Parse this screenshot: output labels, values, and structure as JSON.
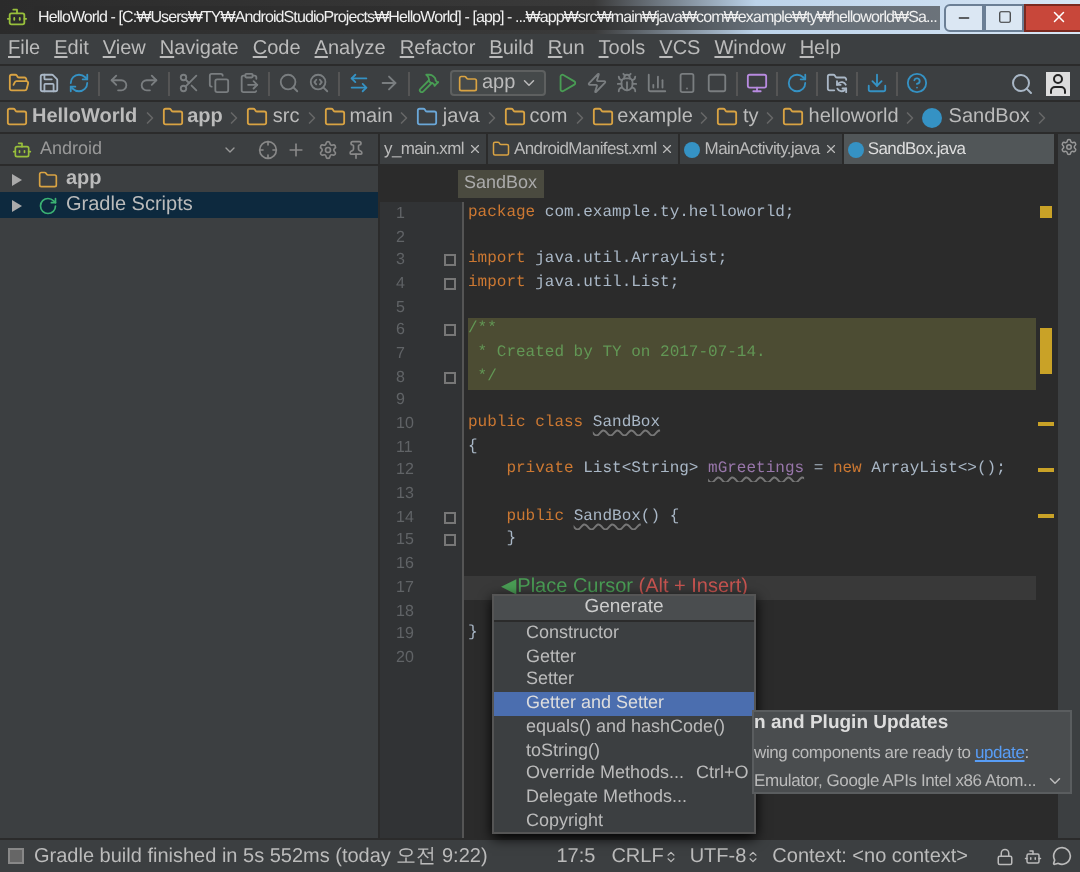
{
  "window": {
    "title": "HelloWorld - [C:₩Users₩TY₩AndroidStudioProjects₩HelloWorld] - [app] - ...₩app₩src₩main₩java₩com₩example₩ty₩helloworld₩Sa..."
  },
  "menu": [
    "File",
    "Edit",
    "View",
    "Navigate",
    "Code",
    "Analyze",
    "Refactor",
    "Build",
    "Run",
    "Tools",
    "VCS",
    "Window",
    "Help"
  ],
  "toolbar": {
    "run_config": "app"
  },
  "breadcrumbs": [
    {
      "label": "HelloWorld",
      "kind": "project"
    },
    {
      "label": "app",
      "kind": "module"
    },
    {
      "label": "src",
      "kind": "folder"
    },
    {
      "label": "main",
      "kind": "folder"
    },
    {
      "label": "java",
      "kind": "source"
    },
    {
      "label": "com",
      "kind": "package"
    },
    {
      "label": "example",
      "kind": "package"
    },
    {
      "label": "ty",
      "kind": "package"
    },
    {
      "label": "helloworld",
      "kind": "package"
    },
    {
      "label": "SandBox",
      "kind": "class"
    }
  ],
  "project_panel": {
    "view": "Android",
    "tree": [
      {
        "label": "app",
        "kind": "module",
        "selected": false
      },
      {
        "label": "Gradle Scripts",
        "kind": "gradle",
        "selected": true
      }
    ]
  },
  "editor_tabs": [
    {
      "label": "y_main.xml",
      "kind": "xml",
      "selected": false
    },
    {
      "label": "AndroidManifest.xml",
      "kind": "manifest",
      "selected": false
    },
    {
      "label": "MainActivity.java",
      "kind": "class",
      "selected": false
    },
    {
      "label": "SandBox.java",
      "kind": "class",
      "selected": true
    }
  ],
  "editor": {
    "breadcrumb": "SandBox",
    "lines": [
      {
        "n": "1",
        "fold": false,
        "highlighted": false,
        "current": false,
        "tokens": [
          {
            "kind": "kw",
            "text": "package"
          },
          {
            "kind": "plain",
            "text": " com.example.ty.helloworld;"
          }
        ]
      },
      {
        "n": "2",
        "fold": false,
        "highlighted": false,
        "current": false
      },
      {
        "n": "3",
        "fold": true,
        "highlighted": false,
        "current": false,
        "tokens": [
          {
            "kind": "kw",
            "text": "import"
          },
          {
            "kind": "plain",
            "text": " java.util.ArrayList;"
          }
        ]
      },
      {
        "n": "4",
        "fold": true,
        "highlighted": false,
        "current": false,
        "tokens": [
          {
            "kind": "kw",
            "text": "import"
          },
          {
            "kind": "plain",
            "text": " java.util.List;"
          }
        ]
      },
      {
        "n": "5",
        "fold": false,
        "highlighted": false,
        "current": false
      },
      {
        "n": "6",
        "fold": true,
        "highlighted": true,
        "current": false,
        "tokens": [
          {
            "kind": "comment",
            "text": "/**"
          }
        ]
      },
      {
        "n": "7",
        "fold": false,
        "highlighted": true,
        "current": false,
        "tokens": [
          {
            "kind": "comment",
            "text": " * Created by TY on 2017-07-14."
          }
        ]
      },
      {
        "n": "8",
        "fold": true,
        "highlighted": true,
        "current": false,
        "tokens": [
          {
            "kind": "comment",
            "text": " */"
          }
        ]
      },
      {
        "n": "9",
        "fold": false,
        "highlighted": false,
        "current": false
      },
      {
        "n": "10",
        "fold": false,
        "highlighted": false,
        "current": false,
        "tokens": [
          {
            "kind": "kw",
            "text": "public class "
          },
          {
            "kind": "warn",
            "text": "SandBox"
          }
        ]
      },
      {
        "n": "11",
        "fold": false,
        "highlighted": false,
        "current": false,
        "tokens": [
          {
            "kind": "plain",
            "text": "{"
          }
        ]
      },
      {
        "n": "12",
        "fold": false,
        "highlighted": false,
        "current": false,
        "tokens": [
          {
            "kind": "kw",
            "text": "    private "
          },
          {
            "kind": "plain",
            "text": "List<String> "
          },
          {
            "kind": "field",
            "text": "mGreetings"
          },
          {
            "kind": "plain",
            "text": " = "
          },
          {
            "kind": "kw",
            "text": "new "
          },
          {
            "kind": "plain",
            "text": "ArrayList<>();"
          }
        ]
      },
      {
        "n": "13",
        "fold": false,
        "highlighted": false,
        "current": false
      },
      {
        "n": "14",
        "fold": true,
        "highlighted": false,
        "current": false,
        "tokens": [
          {
            "kind": "kw",
            "text": "    public "
          },
          {
            "kind": "warn",
            "text": "SandBox"
          },
          {
            "kind": "plain",
            "text": "() {"
          }
        ]
      },
      {
        "n": "15",
        "fold": true,
        "highlighted": false,
        "current": false,
        "tokens": [
          {
            "kind": "plain",
            "text": "    }"
          }
        ]
      },
      {
        "n": "16",
        "fold": false,
        "highlighted": false,
        "current": false
      },
      {
        "n": "17",
        "fold": false,
        "highlighted": false,
        "current": true,
        "tokens": [
          {
            "kind": "hint",
            "text": "      ◀Place Cursor"
          },
          {
            "kind": "hint_key",
            "text": " (Alt + Insert)"
          }
        ]
      },
      {
        "n": "18",
        "fold": false,
        "highlighted": false,
        "current": false
      },
      {
        "n": "19",
        "fold": false,
        "highlighted": false,
        "current": false,
        "tokens": [
          {
            "kind": "plain",
            "text": "}"
          }
        ]
      },
      {
        "n": "20",
        "fold": false,
        "highlighted": false,
        "current": false
      }
    ]
  },
  "popup": {
    "title": "Generate",
    "items": [
      {
        "label": "Constructor",
        "selected": false
      },
      {
        "label": "Getter",
        "selected": false
      },
      {
        "label": "Setter",
        "selected": false
      },
      {
        "label": "Getter and Setter",
        "selected": true
      },
      {
        "label": "equals() and hashCode()",
        "selected": false
      },
      {
        "label": "toString()",
        "selected": false
      },
      {
        "label": "Override Methods...",
        "shortcut": "Ctrl+O",
        "selected": false
      },
      {
        "label": "Delegate Methods...",
        "selected": false
      },
      {
        "label": "Copyright",
        "selected": false
      }
    ]
  },
  "notification": {
    "title": "n and Plugin Updates",
    "text_before": "wing components are ready to ",
    "link": "update",
    "text_after": ":",
    "detail": "Emulator, Google APIs Intel x86 Atom..."
  },
  "status_bar": {
    "message": "Gradle build finished in 5s 552ms (today 오전 9:22)",
    "position": "17:5",
    "line_separator": "CRLF",
    "encoding": "UTF-8",
    "context": "Context: <no context>"
  }
}
